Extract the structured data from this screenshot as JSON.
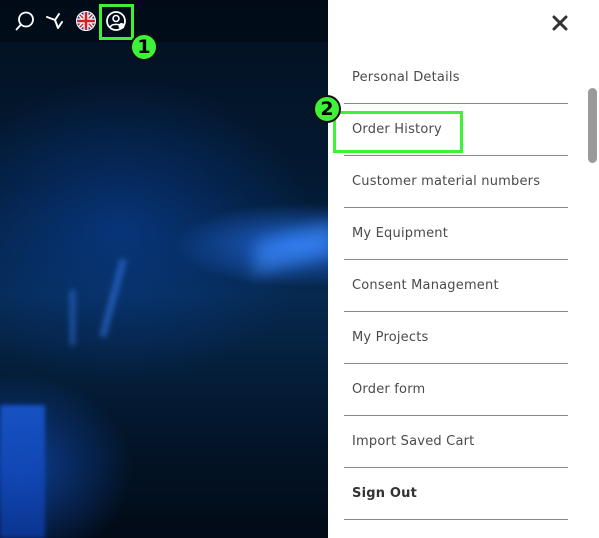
{
  "header": {
    "icons": [
      "search-icon",
      "brand-logo-icon",
      "uk-flag-icon",
      "account-icon"
    ]
  },
  "menu": {
    "items": [
      {
        "label": "Personal Details",
        "bold": false
      },
      {
        "label": "Order History",
        "bold": false
      },
      {
        "label": "Customer material numbers",
        "bold": false
      },
      {
        "label": "My Equipment",
        "bold": false
      },
      {
        "label": "Consent Management",
        "bold": false
      },
      {
        "label": "My Projects",
        "bold": false
      },
      {
        "label": "Order form",
        "bold": false
      },
      {
        "label": "Import Saved Cart",
        "bold": false
      },
      {
        "label": "Sign Out",
        "bold": true
      }
    ],
    "close_icon": "close-icon"
  },
  "annotations": {
    "step1": "1",
    "step2": "2",
    "highlight_color": "#3ef23a"
  }
}
